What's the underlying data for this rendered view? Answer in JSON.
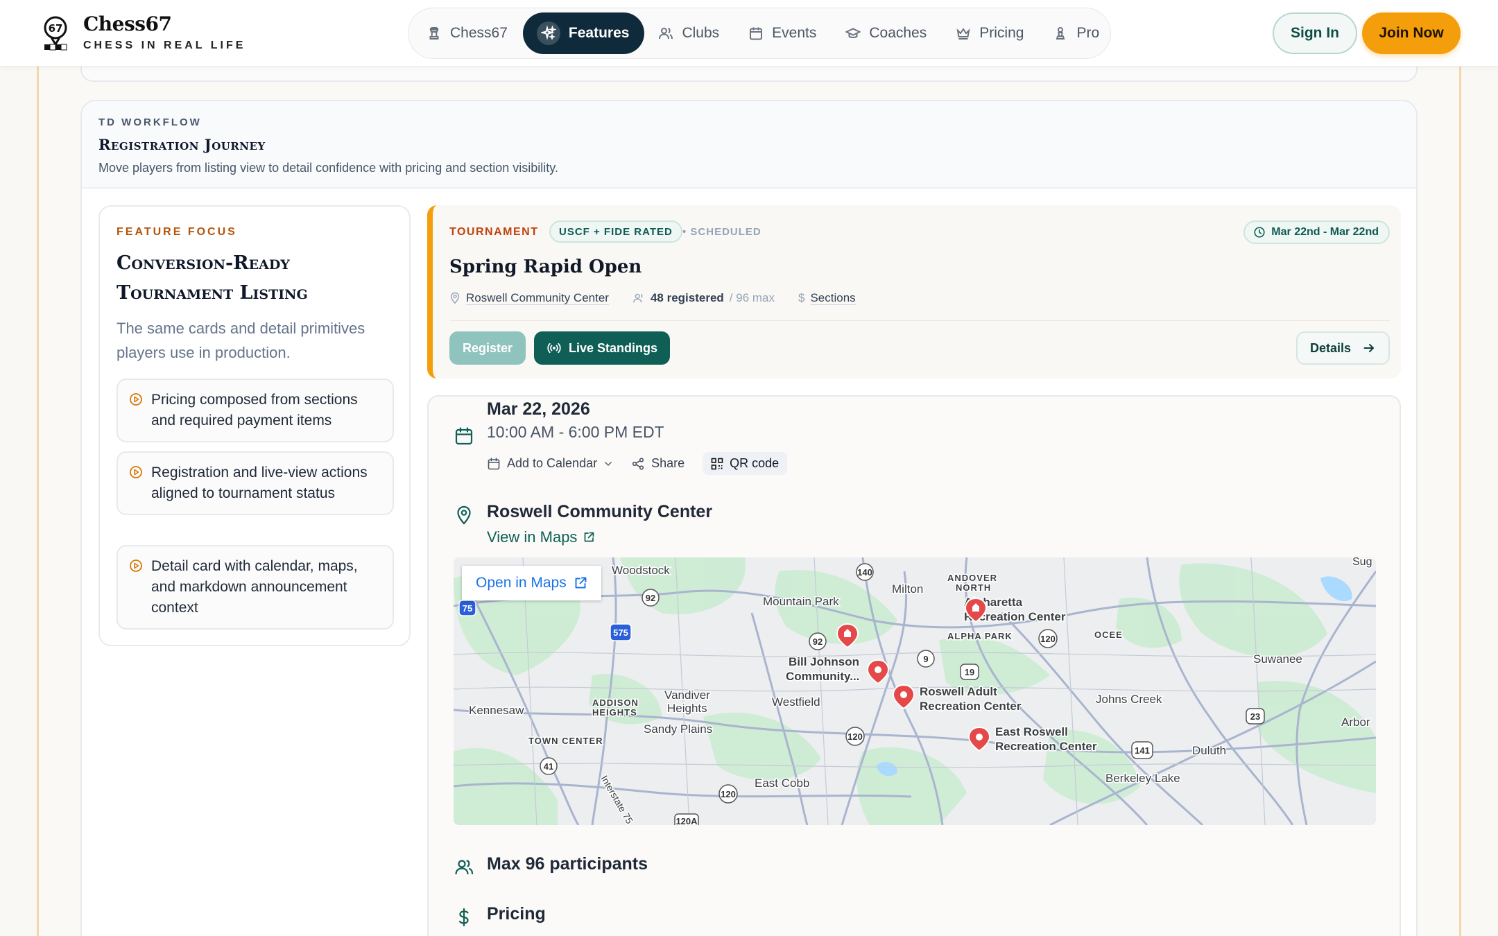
{
  "brand": {
    "title": "Chess67",
    "subtitle": "CHESS IN REAL LIFE"
  },
  "nav": {
    "items": [
      {
        "label": "Chess67",
        "icon": "rook-icon"
      },
      {
        "label": "Features",
        "icon": "sparkles-icon",
        "active": true
      },
      {
        "label": "Clubs",
        "icon": "users-icon"
      },
      {
        "label": "Events",
        "icon": "calendar-icon"
      },
      {
        "label": "Coaches",
        "icon": "graduation-cap-icon"
      },
      {
        "label": "Pricing",
        "icon": "crown-icon"
      },
      {
        "label": "Pro",
        "icon": "pawn-icon"
      }
    ],
    "signin": "Sign In",
    "join": "Join Now"
  },
  "colors": {
    "accent": "#f59e0b",
    "navy": "#0f2a3a",
    "teal": "#0f5f56"
  },
  "section": {
    "eyebrow": "TD WORKFLOW",
    "title": "Registration Journey",
    "desc": "Move players from listing view to detail confidence with pricing and section visibility."
  },
  "focus": {
    "eyebrow": "FEATURE FOCUS",
    "title": "Conversion-Ready Tournament Listing",
    "desc": "The same cards and detail primitives players use in production.",
    "items": [
      "Pricing composed from sections and required payment items",
      "Registration and live-view actions aligned to tournament status",
      "Detail card with calendar, maps, and markdown announcement context"
    ]
  },
  "tournament": {
    "type": "TOURNAMENT",
    "rating": "USCF + FIDE RATED",
    "status": "• SCHEDULED",
    "dates": "Mar 22nd - Mar 22nd",
    "name": "Spring Rapid Open",
    "location": "Roswell Community Center",
    "registered": "48 registered",
    "max": "/ 96 max",
    "sections": "Sections",
    "register": "Register",
    "live": "Live Standings",
    "details": "Details"
  },
  "detail": {
    "date": "Mar 22, 2026",
    "time": "10:00 AM - 6:00 PM EDT",
    "add_calendar": "Add to Calendar",
    "share": "Share",
    "qr": "QR code",
    "place": "Roswell Community Center",
    "view_maps": "View in Maps",
    "open_maps": "Open in Maps",
    "max": "Max 96 participants",
    "pricing": "Pricing"
  },
  "map": {
    "labels": {
      "woodstock": "Woodstock",
      "milton": "Milton",
      "mountain_park": "Mountain Park",
      "andover": "ANDOVER",
      "andover2": "NORTH",
      "alpharetta_rec": "Alpharetta",
      "alpharetta_rec2": "Recreation Center",
      "alpha_park": "ALPHA PARK",
      "ocee": "OCEE",
      "suwanee": "Suwanee",
      "bill_johnson": "Bill Johnson",
      "bill_johnson2": "Community...",
      "roswell_adult": "Roswell Adult",
      "roswell_adult2": "Recreation Center",
      "johns_creek": "Johns Creek",
      "kennesaw": "Kennesaw",
      "addison": "ADDISON",
      "addison2": "HEIGHTS",
      "vandiver": "Vandiver",
      "vandiver2": "Heights",
      "westfield": "Westfield",
      "east_roswell": "East Roswell",
      "east_roswell2": "Recreation Center",
      "town_center": "TOWN CENTER",
      "sandy_plains": "Sandy Plains",
      "arbor": "Arbor",
      "duluth": "Duluth",
      "east_cobb": "East Cobb",
      "berkeley_lake": "Berkeley Lake",
      "interstate": "Interstate 75",
      "sug": "Sug"
    }
  }
}
